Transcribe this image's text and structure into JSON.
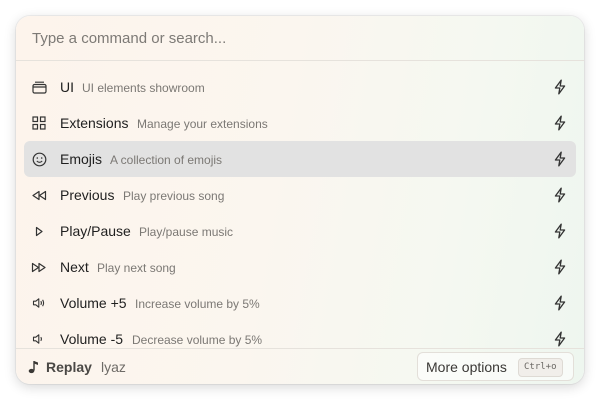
{
  "search": {
    "placeholder": "Type a command or search..."
  },
  "items": [
    {
      "title": "UI",
      "subtitle": "UI elements showroom",
      "icon": "window-icon",
      "action_icon": "bolt-icon"
    },
    {
      "title": "Extensions",
      "subtitle": "Manage your extensions",
      "icon": "grid-icon",
      "action_icon": "bolt-icon"
    },
    {
      "title": "Emojis",
      "subtitle": "A collection of emojis",
      "icon": "smiley-icon",
      "action_icon": "bolt-icon",
      "selected": true
    },
    {
      "title": "Previous",
      "subtitle": "Play previous song",
      "icon": "rewind-icon",
      "action_icon": "bolt-icon"
    },
    {
      "title": "Play/Pause",
      "subtitle": "Play/pause music",
      "icon": "play-icon",
      "action_icon": "bolt-icon"
    },
    {
      "title": "Next",
      "subtitle": "Play next song",
      "icon": "fast-forward-icon",
      "action_icon": "bolt-icon"
    },
    {
      "title": "Volume +5",
      "subtitle": "Increase volume by 5%",
      "icon": "volume-up-icon",
      "action_icon": "bolt-icon"
    },
    {
      "title": "Volume -5",
      "subtitle": "Decrease volume by 5%",
      "icon": "volume-down-icon",
      "action_icon": "bolt-icon"
    }
  ],
  "footer": {
    "icon": "music-note-icon",
    "app_name": "Replay",
    "user": "lyaz",
    "more_options_label": "More options",
    "shortcut": "Ctrl+o"
  },
  "colors": {
    "selected_row": "#e2e2e2",
    "text": "#1f1f1f",
    "muted": "#7b7874"
  }
}
